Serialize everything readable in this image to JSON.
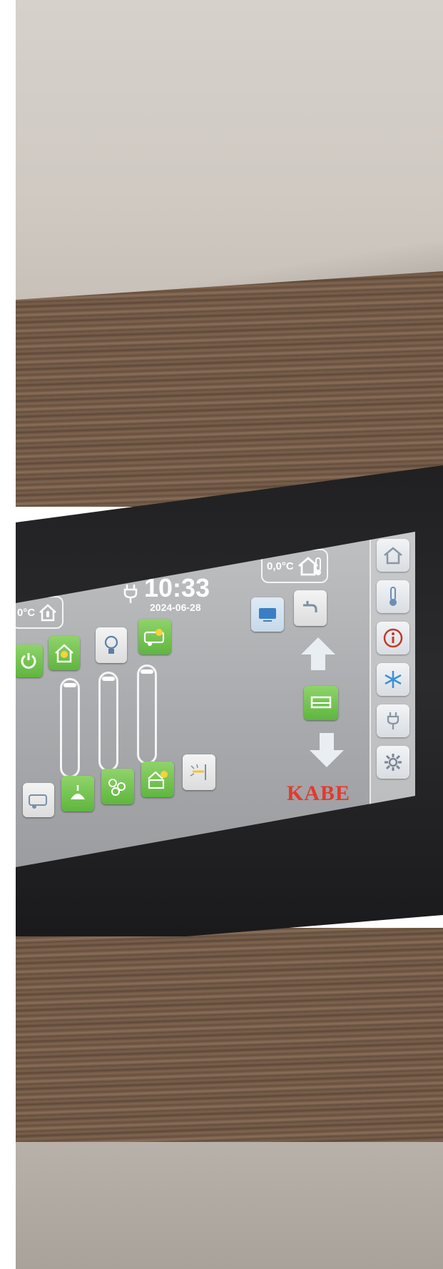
{
  "brand": "KABE",
  "status": {
    "time": "10:33",
    "date": "2024-06-28",
    "outside_temp": "0,0°C",
    "inside_temp_partial": "0°C"
  },
  "colors": {
    "active_green": "#6cc24a",
    "brand_red": "#e23a2e",
    "screen_bg": "#a9abae"
  },
  "top_controls": [
    {
      "name": "power-button",
      "icon": "power-icon",
      "active": true
    },
    {
      "name": "house-light-button",
      "icon": "house-bulb-icon",
      "active": true
    },
    {
      "name": "bulb-button",
      "icon": "bulb-icon",
      "active": false
    },
    {
      "name": "caravan-light-button",
      "icon": "caravan-bulb-icon",
      "active": true
    }
  ],
  "bottom_controls": [
    {
      "name": "awning-light-button",
      "icon": "caravan-awning-icon",
      "active": false
    },
    {
      "name": "ceiling-lamp-button",
      "icon": "ceiling-lamp-icon",
      "active": true
    },
    {
      "name": "spotlights-button",
      "icon": "spotlights-icon",
      "active": true
    },
    {
      "name": "kitchen-light-button",
      "icon": "kitchen-bulb-icon",
      "active": true
    },
    {
      "name": "wall-lamp-button",
      "icon": "wall-lamp-icon",
      "active": false
    }
  ],
  "right_controls": [
    {
      "name": "tv-button",
      "icon": "tv-icon"
    },
    {
      "name": "faucet-button",
      "icon": "faucet-icon"
    },
    {
      "name": "bed-button",
      "icon": "bed-icon"
    }
  ],
  "sidebar": [
    {
      "name": "home",
      "icon": "home-icon"
    },
    {
      "name": "temperature",
      "icon": "thermometer-icon"
    },
    {
      "name": "info",
      "icon": "info-icon"
    },
    {
      "name": "cooling",
      "icon": "snowflake-icon"
    },
    {
      "name": "power-supply",
      "icon": "plug-icon"
    },
    {
      "name": "settings",
      "icon": "gear-icon"
    }
  ]
}
